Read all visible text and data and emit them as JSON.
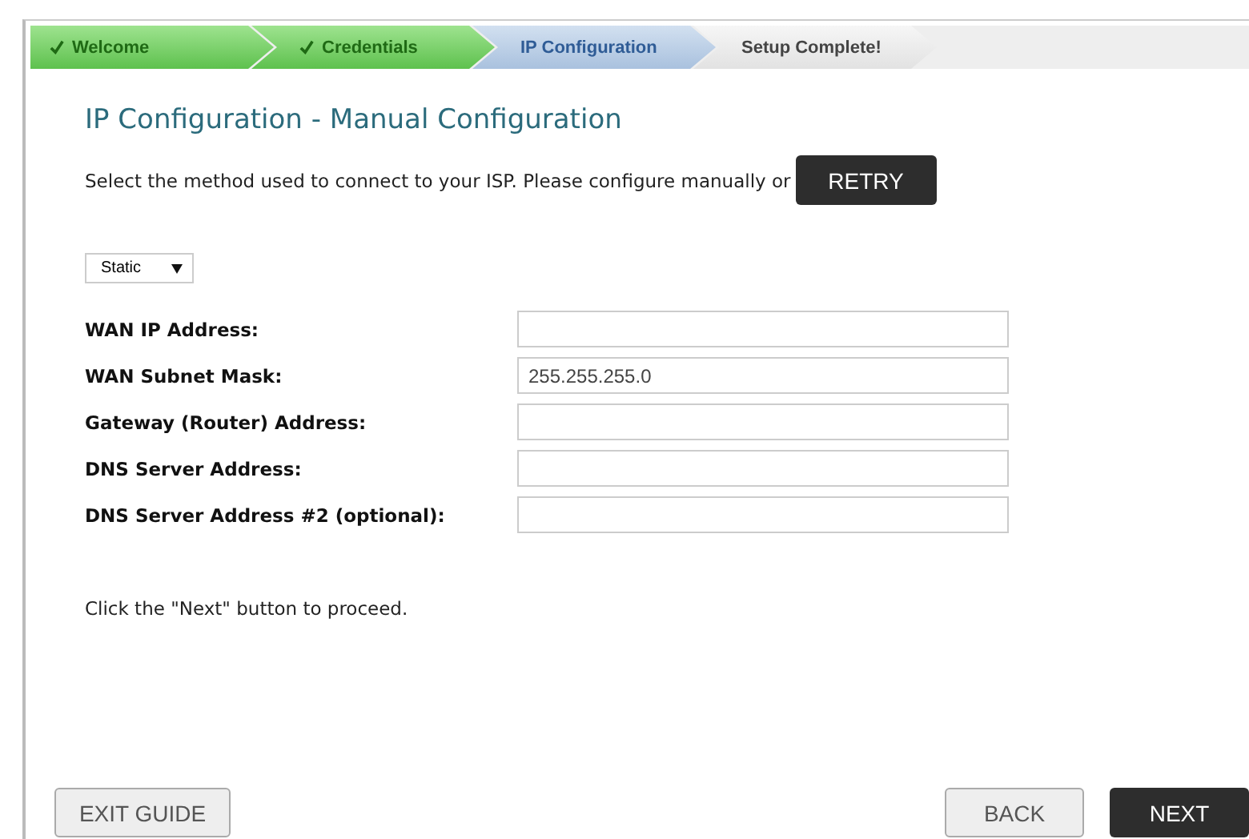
{
  "steps": [
    {
      "label": "Welcome",
      "completed": true,
      "selected": false
    },
    {
      "label": "Credentials",
      "completed": true,
      "selected": false
    },
    {
      "label": "IP Configuration",
      "completed": false,
      "selected": true
    },
    {
      "label": "Setup Complete!",
      "completed": false,
      "selected": false
    }
  ],
  "title": "IP Configuration - Manual Configuration",
  "intro": "Select the method used to connect to your ISP. Please configure manually or",
  "retry_button": "RETRY",
  "mode_select": {
    "value": "Static"
  },
  "fields": [
    {
      "label": "WAN IP Address:"
    },
    {
      "label": "WAN Subnet Mask:",
      "value": "255.255.255.0"
    },
    {
      "label": "Gateway (Router) Address:"
    },
    {
      "label": "DNS Server Address:"
    },
    {
      "label": "DNS Server Address #2 (optional):"
    }
  ],
  "hint": "Click the \"Next\" button to proceed.",
  "footer": {
    "exit": "EXIT GUIDE",
    "back": "BACK",
    "next": "NEXT"
  }
}
